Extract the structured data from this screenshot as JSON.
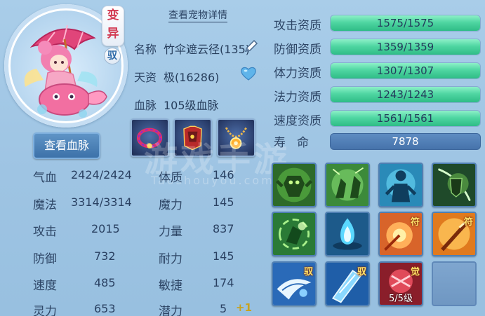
{
  "header": {
    "detail_link": "查看宠物详情",
    "variant_badge": "变\n异",
    "ride_badge": "驭"
  },
  "buttons": {
    "lineage": "查看血脉"
  },
  "info": {
    "name_label": "名称",
    "name_value": "竹伞遮云径(135)",
    "talent_label": "天资",
    "talent_value": "极(16286)",
    "bloodline_label": "血脉",
    "bloodline_value": "105级血脉"
  },
  "stats": [
    {
      "label": "气血",
      "value": "2424/2424",
      "label2": "体质",
      "value2": "146"
    },
    {
      "label": "魔法",
      "value": "3314/3314",
      "label2": "魔力",
      "value2": "145"
    },
    {
      "label": "攻击",
      "value": "2015",
      "label2": "力量",
      "value2": "837"
    },
    {
      "label": "防御",
      "value": "732",
      "label2": "耐力",
      "value2": "145"
    },
    {
      "label": "速度",
      "value": "485",
      "label2": "敏捷",
      "value2": "174"
    },
    {
      "label": "灵力",
      "value": "653",
      "label2": "潜力",
      "value2": "5"
    }
  ],
  "potential_bonus": "+1",
  "aptitudes": [
    {
      "label": "攻击资质",
      "text": "1575/1575",
      "fill": 1.0
    },
    {
      "label": "防御资质",
      "text": "1359/1359",
      "fill": 1.0
    },
    {
      "label": "体力资质",
      "text": "1307/1307",
      "fill": 1.0
    },
    {
      "label": "法力资质",
      "text": "1243/1243",
      "fill": 1.0
    },
    {
      "label": "速度资质",
      "text": "1561/1561",
      "fill": 1.0
    }
  ],
  "life": {
    "label": "寿命",
    "value": "7878"
  },
  "skills": [
    {
      "icon": "stone-giant-skill-icon"
    },
    {
      "icon": "twin-warriors-skill-icon"
    },
    {
      "icon": "shadow-figure-skill-icon"
    },
    {
      "icon": "shield-warrior-skill-icon"
    },
    {
      "icon": "green-vortex-skill-icon"
    },
    {
      "icon": "blue-flame-skill-icon"
    },
    {
      "icon": "fire-talisman-skill-icon",
      "tag": "符"
    },
    {
      "icon": "golden-sword-skill-icon",
      "tag": "符"
    },
    {
      "icon": "ride-whirl-skill-icon",
      "tag": "驭"
    },
    {
      "icon": "ride-crystal-skill-icon",
      "tag": "驭"
    },
    {
      "icon": "awaken-skill-icon",
      "tag": "觉",
      "level": "5/5级"
    }
  ],
  "watermark": "游戏手游",
  "watermark_sub": "Taoshouyou.com",
  "colors": {
    "accent_green": "#4fd6a2",
    "bg_blue": "#a9cde9",
    "button_blue": "#3d72a9",
    "variant_red": "#d23a52",
    "bonus_gold": "#c8a21e"
  }
}
